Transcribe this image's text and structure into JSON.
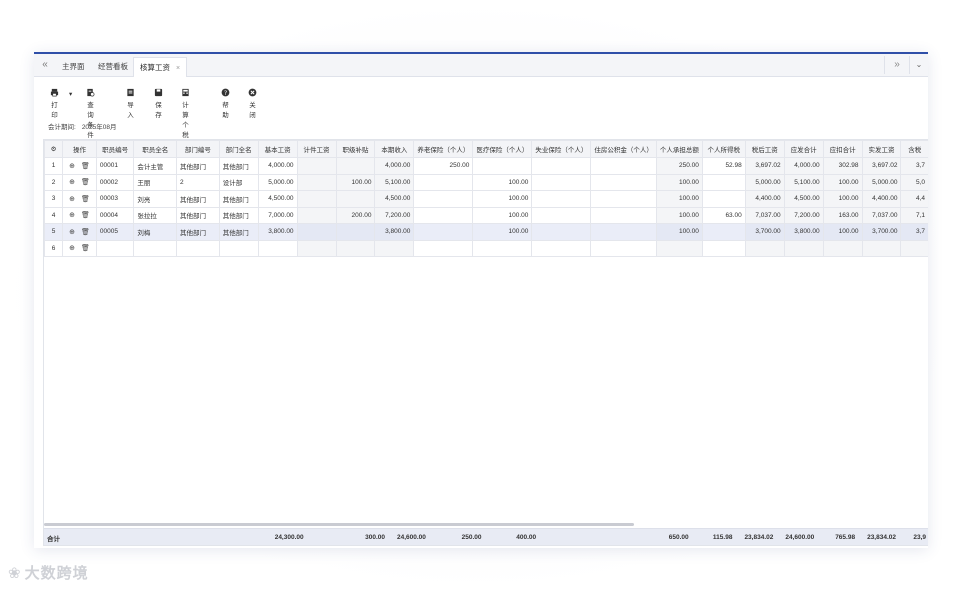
{
  "tabs": {
    "nav_left": "«",
    "items": [
      {
        "label": "主界面"
      },
      {
        "label": "经营看板"
      },
      {
        "label": "核算工资",
        "close": "×"
      }
    ],
    "nav_right": "»",
    "dropdown": "⌄"
  },
  "toolbar": {
    "print": "打印",
    "print_arrow": "▾",
    "query": "查询条件",
    "import": "导入",
    "save": "保存",
    "calc_tax": "计算个税",
    "help": "帮助",
    "close": "关闭"
  },
  "period": {
    "label": "会计期间:",
    "value": "2025年08月"
  },
  "columns": {
    "settings": "⚙",
    "op": "操作",
    "emp_no": "职员编号",
    "emp_name": "职员全名",
    "dept_no": "部门编号",
    "dept_name": "部门全名",
    "base": "基本工资",
    "piece": "计件工资",
    "allow": "职级补贴",
    "income": "本期收入",
    "pension": "养老保险（个人）",
    "medical": "医疗保险（个人）",
    "unemp": "失业保险（个人）",
    "housing": "住房公积金（个人）",
    "personal_total": "个人承担总额",
    "tax": "个人所得税",
    "after_tax": "税后工资",
    "payable": "应发合计",
    "deduct": "应扣合计",
    "actual": "实发工资",
    "tax_incl": "含税"
  },
  "rows": [
    {
      "idx": "1",
      "emp_no": "00001",
      "emp_name": "会计主管",
      "dept_no": "其他部门",
      "dept_name": "其他部门",
      "base": "4,000.00",
      "piece": "",
      "allow": "",
      "income": "4,000.00",
      "pension": "250.00",
      "medical": "",
      "unemp": "",
      "housing": "",
      "personal_total": "250.00",
      "tax": "52.98",
      "after_tax": "3,697.02",
      "payable": "4,000.00",
      "deduct": "302.98",
      "actual": "3,697.02",
      "tax_incl": "3,7"
    },
    {
      "idx": "2",
      "emp_no": "00002",
      "emp_name": "王丽",
      "dept_no": "2",
      "dept_name": "设计部",
      "base": "5,000.00",
      "piece": "",
      "allow": "100.00",
      "income": "5,100.00",
      "pension": "",
      "medical": "100.00",
      "unemp": "",
      "housing": "",
      "personal_total": "100.00",
      "tax": "",
      "after_tax": "5,000.00",
      "payable": "5,100.00",
      "deduct": "100.00",
      "actual": "5,000.00",
      "tax_incl": "5,0"
    },
    {
      "idx": "3",
      "emp_no": "00003",
      "emp_name": "刘亮",
      "dept_no": "其他部门",
      "dept_name": "其他部门",
      "base": "4,500.00",
      "piece": "",
      "allow": "",
      "income": "4,500.00",
      "pension": "",
      "medical": "100.00",
      "unemp": "",
      "housing": "",
      "personal_total": "100.00",
      "tax": "",
      "after_tax": "4,400.00",
      "payable": "4,500.00",
      "deduct": "100.00",
      "actual": "4,400.00",
      "tax_incl": "4,4"
    },
    {
      "idx": "4",
      "emp_no": "00004",
      "emp_name": "张拉拉",
      "dept_no": "其他部门",
      "dept_name": "其他部门",
      "base": "7,000.00",
      "piece": "",
      "allow": "200.00",
      "income": "7,200.00",
      "pension": "",
      "medical": "100.00",
      "unemp": "",
      "housing": "",
      "personal_total": "100.00",
      "tax": "63.00",
      "after_tax": "7,037.00",
      "payable": "7,200.00",
      "deduct": "163.00",
      "actual": "7,037.00",
      "tax_incl": "7,1"
    },
    {
      "idx": "5",
      "emp_no": "00005",
      "emp_name": "刘梅",
      "dept_no": "其他部门",
      "dept_name": "其他部门",
      "base": "3,800.00",
      "piece": "",
      "allow": "",
      "income": "3,800.00",
      "pension": "",
      "medical": "100.00",
      "unemp": "",
      "housing": "",
      "personal_total": "100.00",
      "tax": "",
      "after_tax": "3,700.00",
      "payable": "3,800.00",
      "deduct": "100.00",
      "actual": "3,700.00",
      "tax_incl": "3,7"
    },
    {
      "idx": "6",
      "emp_no": "",
      "emp_name": "",
      "dept_no": "",
      "dept_name": "",
      "base": "",
      "piece": "",
      "allow": "",
      "income": "",
      "pension": "",
      "medical": "",
      "unemp": "",
      "housing": "",
      "personal_total": "",
      "tax": "",
      "after_tax": "",
      "payable": "",
      "deduct": "",
      "actual": "",
      "tax_incl": ""
    }
  ],
  "totals": {
    "label": "合计",
    "base": "24,300.00",
    "allow": "300.00",
    "income": "24,600.00",
    "pension": "250.00",
    "medical": "400.00",
    "personal_total": "650.00",
    "tax": "115.98",
    "after_tax": "23,834.02",
    "payable": "24,600.00",
    "deduct": "765.98",
    "actual": "23,834.02",
    "tax_incl": "23,9"
  },
  "watermark": "大数跨境",
  "icons": {
    "add": "⊕",
    "delete": "🗑"
  }
}
